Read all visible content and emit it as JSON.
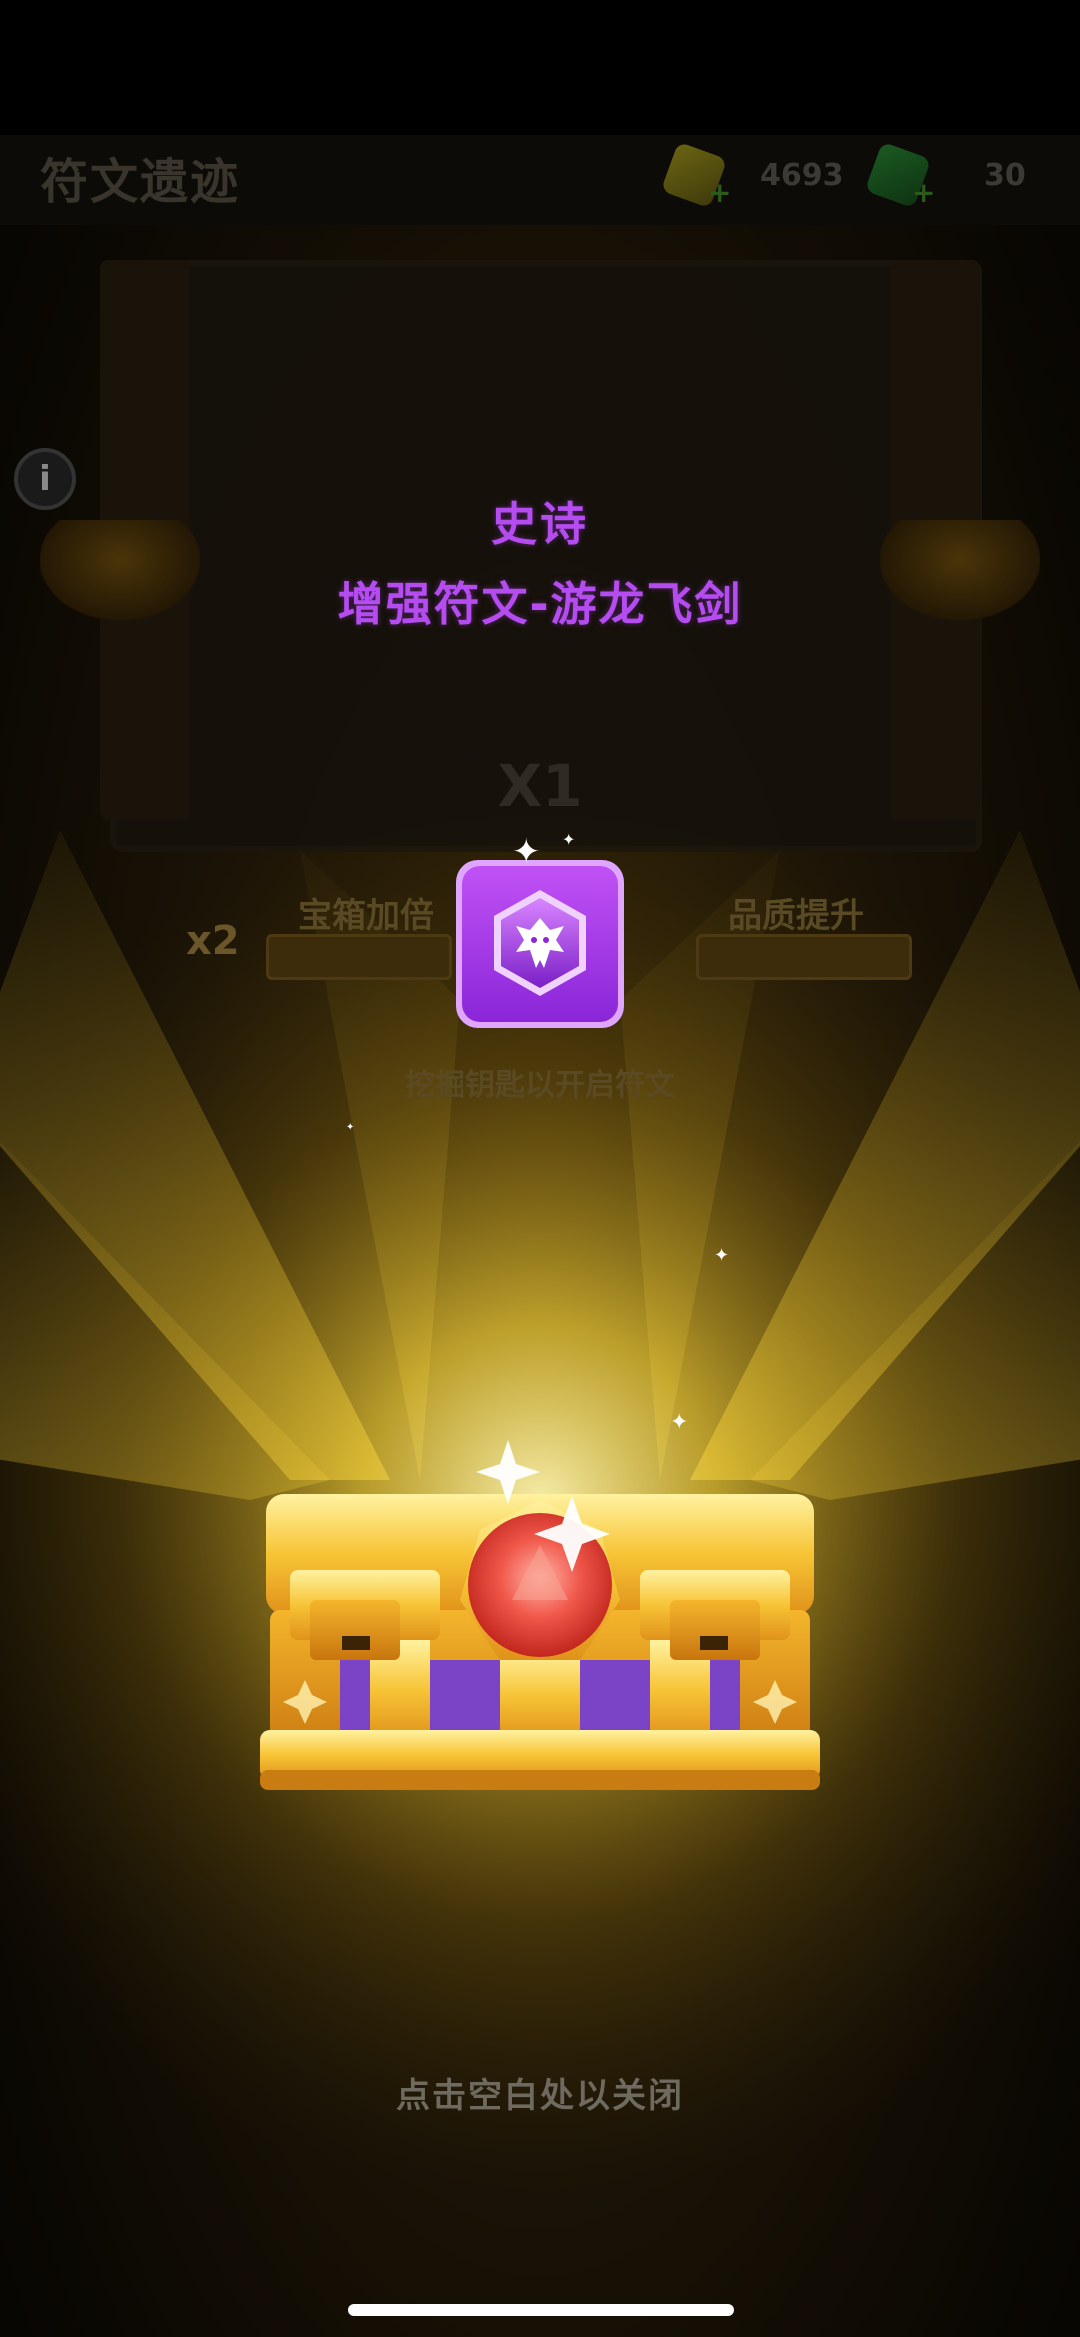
{
  "header": {
    "title": "符文遗迹",
    "currency": [
      {
        "icon": "gold-gem-icon",
        "value": "4693",
        "color": "#d4c11a"
      },
      {
        "icon": "green-gem-icon",
        "value": "30",
        "color": "#1fb33a"
      }
    ]
  },
  "reward": {
    "rarity": "史诗",
    "item_name": "增强符文-游龙飞剑",
    "quantity": "X1",
    "rarity_color": "#b44cf0",
    "icon": "dragon-rune-icon"
  },
  "background": {
    "bonus_left_label": "宝箱加倍",
    "bonus_left_badge": "x2",
    "bonus_right_label": "品质提升",
    "dig_hint": "挖掘钥匙以开启符文"
  },
  "footer": {
    "close_hint": "点击空白处以关闭"
  }
}
